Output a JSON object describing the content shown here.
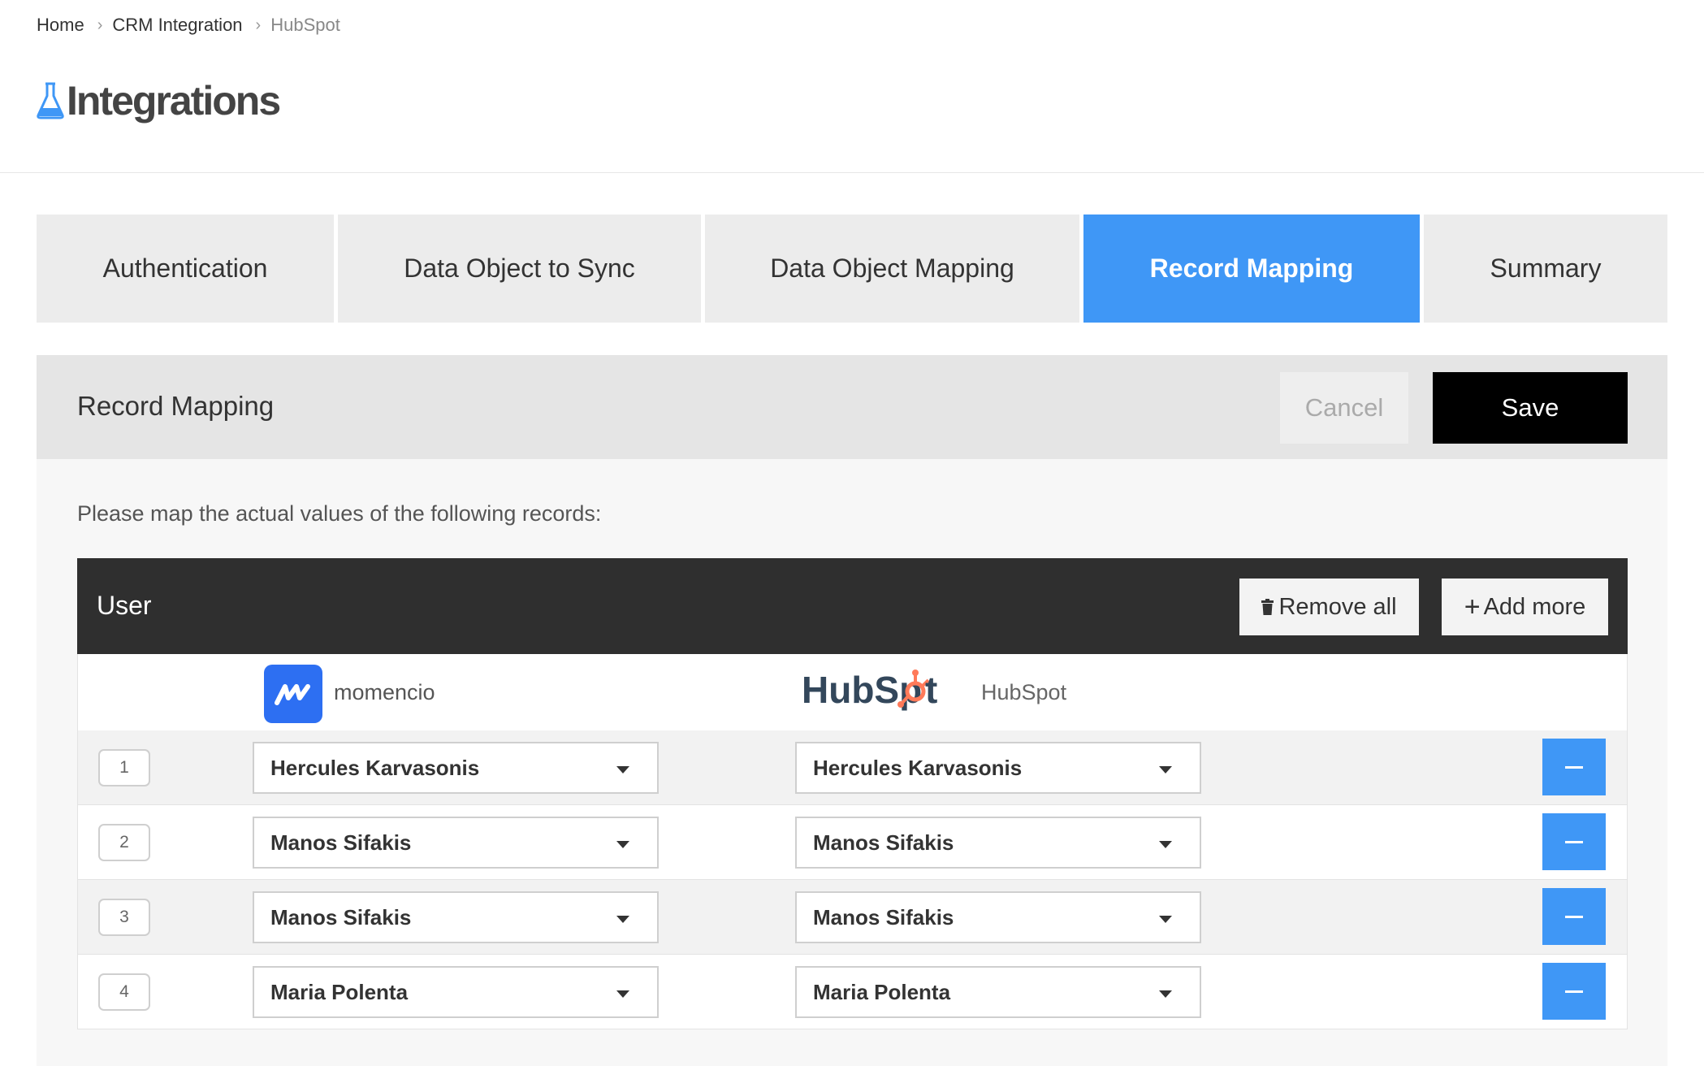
{
  "breadcrumb": {
    "items": [
      "Home",
      "CRM Integration",
      "HubSpot"
    ]
  },
  "page": {
    "title": "Integrations",
    "icon": "flask-icon",
    "accent_color": "#3f97f6"
  },
  "tabs": [
    {
      "label": "Authentication",
      "active": false
    },
    {
      "label": "Data Object to Sync",
      "active": false
    },
    {
      "label": "Data Object Mapping",
      "active": false
    },
    {
      "label": "Record Mapping",
      "active": true
    },
    {
      "label": "Summary",
      "active": false
    }
  ],
  "panel": {
    "title": "Record Mapping",
    "cancel_label": "Cancel",
    "save_label": "Save",
    "instruction": "Please map the actual values of the following records:"
  },
  "user_block": {
    "title": "User",
    "remove_all_label": "Remove all",
    "add_more_label": "Add more",
    "source": {
      "name": "momencio",
      "logo_color": "#2d6ff2"
    },
    "target": {
      "name": "HubSpot",
      "logo_text": "HubSpot",
      "logo_color": "#ff7a59"
    },
    "rows": [
      {
        "num": "1",
        "source_value": "Hercules Karvasonis",
        "target_value": "Hercules Karvasonis"
      },
      {
        "num": "2",
        "source_value": "Manos Sifakis",
        "target_value": "Manos Sifakis"
      },
      {
        "num": "3",
        "source_value": "Manos Sifakis",
        "target_value": "Manos Sifakis"
      },
      {
        "num": "4",
        "source_value": "Maria Polenta",
        "target_value": "Maria Polenta"
      }
    ]
  }
}
